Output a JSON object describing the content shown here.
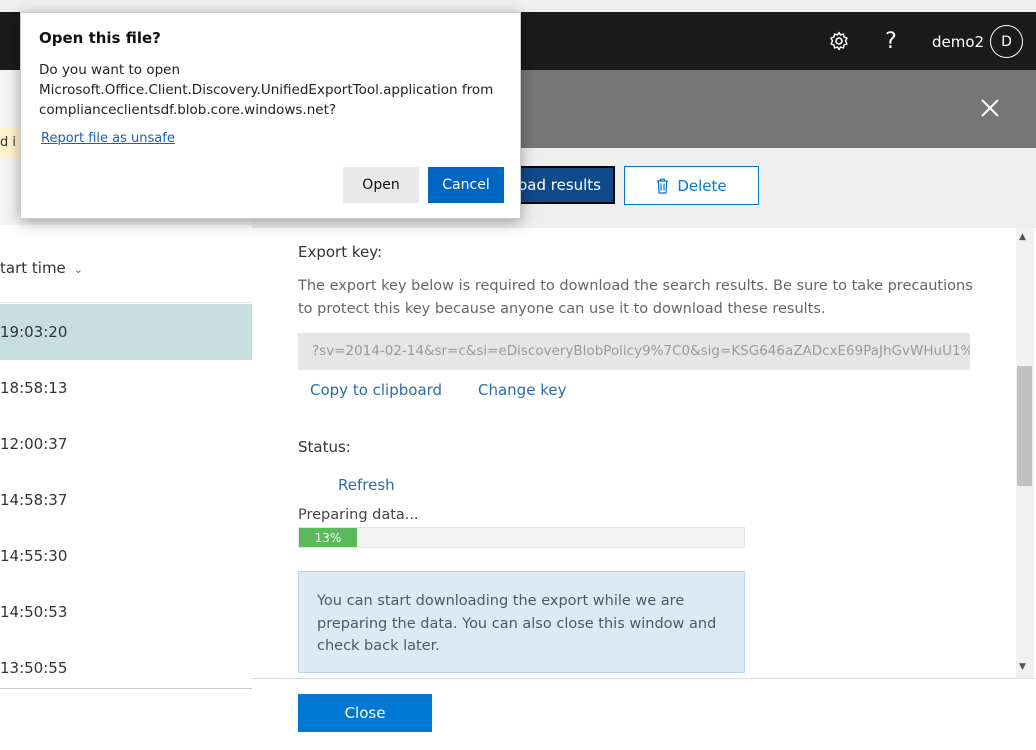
{
  "topbar": {
    "settings_icon": "gear-icon",
    "help_icon": "question-icon",
    "help_glyph": "?",
    "user_name": "demo2",
    "avatar_initial": "D"
  },
  "left_pane": {
    "warning_fragment": "d i",
    "column_header": "tart time",
    "rows": [
      "19:03:20",
      "18:58:13",
      "12:00:37",
      "14:58:37",
      "14:55:30",
      "14:50:53",
      "13:50:55"
    ]
  },
  "panel": {
    "download_label": "load results",
    "delete_label": "Delete",
    "export_key_heading": "Export key:",
    "export_key_desc": "The export key below is required to download the search results. Be sure to take precautions to protect this key because anyone can use it to download these results.",
    "export_key_value": "?sv=2014-02-14&sr=c&si=eDiscoveryBlobPolicy9%7C0&sig=KSG646aZADcxE69PaJhGvWHuU1%",
    "copy_link": "Copy to clipboard",
    "change_key_link": "Change key",
    "status_heading": "Status:",
    "refresh_link": "Refresh",
    "progress_label": "Preparing data...",
    "progress_percent": 13,
    "progress_text": "13%",
    "info_text": "You can start downloading the export while we are preparing the data. You can also close this window and check back later.",
    "close_label": "Close"
  },
  "dialog": {
    "title": "Open this file?",
    "message": "Do you want to open Microsoft.Office.Client.Discovery.UnifiedExportTool.application from complianceclientsdf.blob.core.windows.net?",
    "report_link": "Report file as unsafe",
    "open_label": "Open",
    "cancel_label": "Cancel"
  },
  "colors": {
    "accent": "#0078d4",
    "progress_green": "#5cb85c",
    "selected_row": "#c7dfe0"
  }
}
